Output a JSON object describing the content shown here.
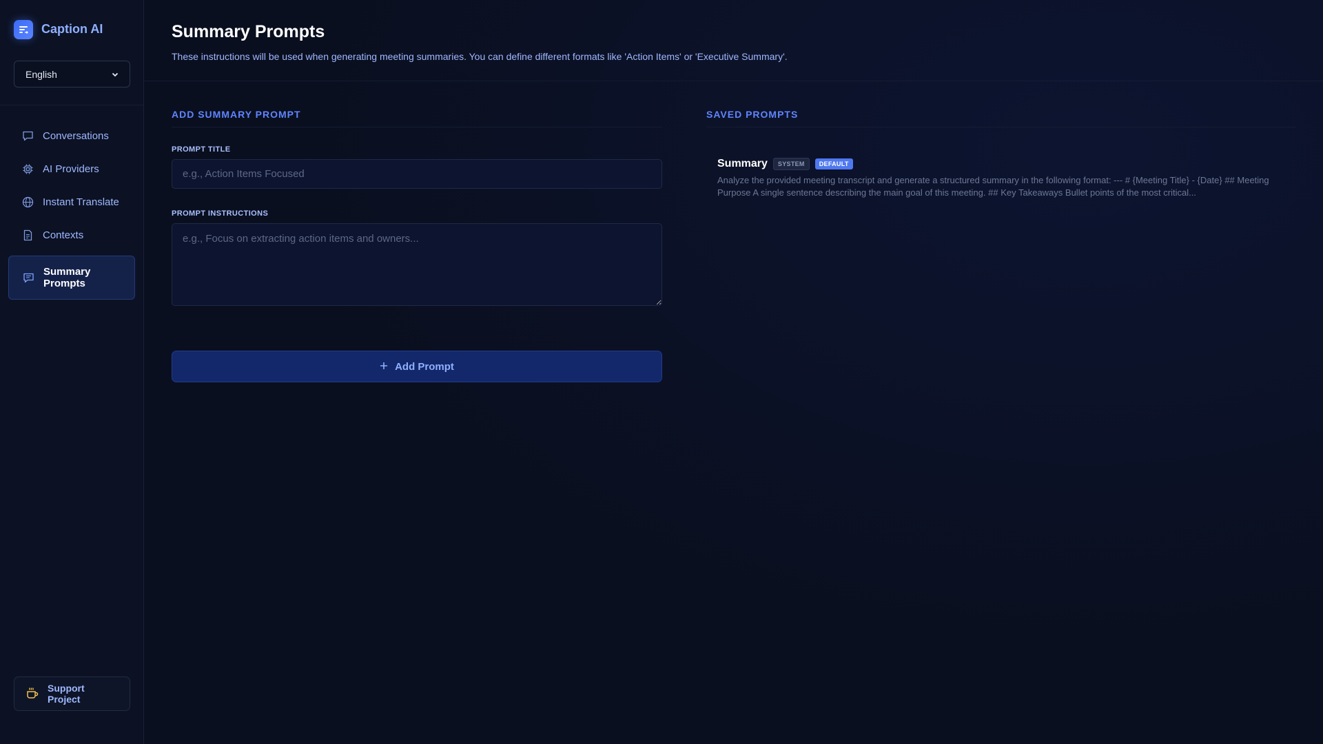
{
  "app": {
    "name": "Caption AI",
    "logo_icon": "lines-arrow-icon"
  },
  "language": {
    "selected": "English"
  },
  "nav": {
    "items": [
      {
        "label": "Conversations",
        "icon": "chat-bubble-icon"
      },
      {
        "label": "AI Providers",
        "icon": "cpu-chip-icon"
      },
      {
        "label": "Instant Translate",
        "icon": "globe-icon"
      },
      {
        "label": "Contexts",
        "icon": "document-icon"
      },
      {
        "label": "Summary Prompts",
        "icon": "message-lines-icon",
        "active": true
      }
    ]
  },
  "support": {
    "label": "Support Project",
    "icon": "coffee-cup-icon"
  },
  "header": {
    "title": "Summary Prompts",
    "description": "These instructions will be used when generating meeting summaries. You can define different formats like 'Action Items' or 'Executive Summary'."
  },
  "add_form": {
    "section_title": "ADD SUMMARY PROMPT",
    "title_label": "PROMPT TITLE",
    "title_placeholder": "e.g., Action Items Focused",
    "title_value": "",
    "instructions_label": "PROMPT INSTRUCTIONS",
    "instructions_placeholder": "e.g., Focus on extracting action items and owners...",
    "instructions_value": "",
    "button_label": "Add Prompt",
    "button_icon": "plus-icon"
  },
  "saved": {
    "section_title": "SAVED PROMPTS",
    "prompts": [
      {
        "name": "Summary",
        "badges": [
          "SYSTEM",
          "DEFAULT"
        ],
        "preview": "Analyze the provided meeting transcript and generate a structured summary in the following format: --- # {Meeting Title} - {Date} ## Meeting Purpose A single sentence describing the main goal of this meeting. ## Key Takeaways Bullet points of the most critical..."
      }
    ]
  },
  "colors": {
    "background": "#0b1020",
    "accent": "#5f85ff",
    "default_badge": "#4f78f0",
    "support_icon": "#f2c14e"
  }
}
